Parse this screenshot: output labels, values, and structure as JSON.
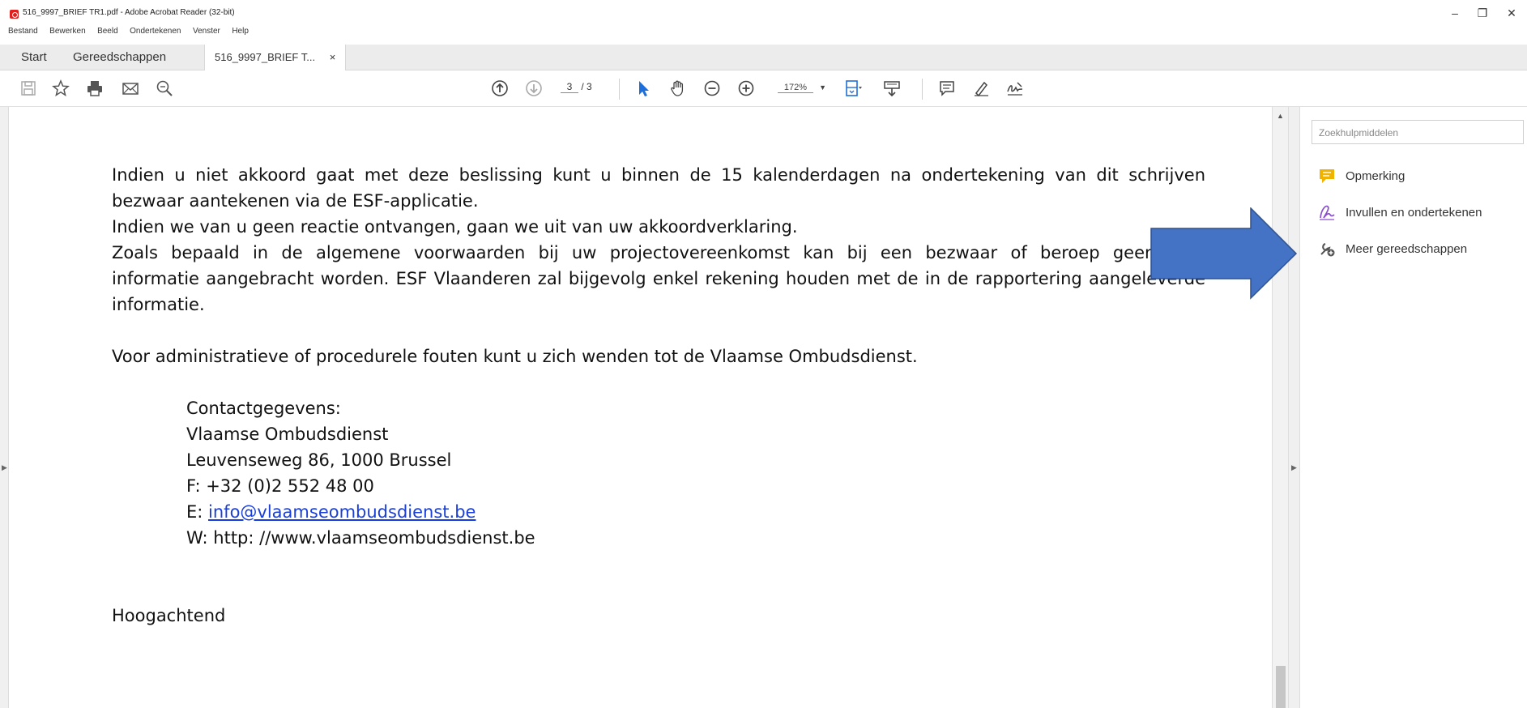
{
  "window": {
    "title": "516_9997_BRIEF TR1.pdf - Adobe Acrobat Reader (32-bit)",
    "minimize": "–",
    "restore": "❐",
    "close": "✕"
  },
  "menu": [
    "Bestand",
    "Bewerken",
    "Beeld",
    "Ondertekenen",
    "Venster",
    "Help"
  ],
  "tabs": {
    "start": "Start",
    "tools": "Gereedschappen",
    "doc": "516_9997_BRIEF T...",
    "doc_close": "×"
  },
  "toolbar": {
    "page_current": "3",
    "page_total": "/ 3",
    "zoom": "172%"
  },
  "document": {
    "para1_line1": "Indien u niet akkoord gaat met deze beslissing kunt u binnen de 15 kalenderdagen na ondertekening van dit schrijven",
    "para1_line2": "bezwaar aantekenen via de ESF-applicatie.",
    "para2": "Indien we van u geen reactie ontvangen, gaan we uit van uw akkoordverklaring.",
    "para3_line1": "Zoals bepaald in de algemene voorwaarden bij uw projectovereenkomst kan bij een bezwaar of beroep geen nieu",
    "para3_line2": "informatie aangebracht worden. ESF Vlaanderen zal bijgevolg enkel rekening houden met de in de rapportering aangeleverde",
    "para3_line3": "informatie.",
    "para4": "Voor administratieve of procedurele fouten kunt u zich wenden tot de Vlaamse Ombudsdienst.",
    "contact_heading": "Contactgegevens:",
    "contact_name": "Vlaamse Ombudsdienst",
    "contact_address": "Leuvenseweg 86, 1000 Brussel",
    "contact_fax": "F: +32 (0)2 552 48 00",
    "contact_email_prefix": "E: ",
    "contact_email": "info@vlaamseombudsdienst.be",
    "contact_web": "W: http: //www.vlaamseombudsdienst.be",
    "closing": "Hoogachtend"
  },
  "right_panel": {
    "search_placeholder": "Zoekhulpmiddelen",
    "items": [
      {
        "label": "Opmerking",
        "icon": "comment-icon",
        "color": "#f0b400"
      },
      {
        "label": "Invullen en ondertekenen",
        "icon": "fill-sign-icon",
        "color": "#8a4fd0"
      },
      {
        "label": "Meer gereedschappen",
        "icon": "more-tools-icon",
        "color": "#555555"
      }
    ]
  },
  "colors": {
    "arrow_fill": "#4472c4",
    "arrow_stroke": "#2f528f",
    "link": "#1a3fd8",
    "pdf_red": "#e0201c"
  }
}
